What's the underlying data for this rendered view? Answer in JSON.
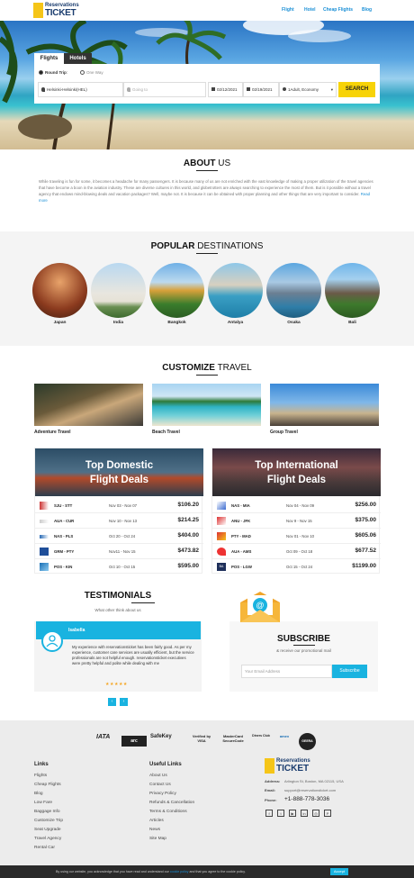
{
  "header": {
    "logo_line1": "Reservations",
    "logo_line2": "TICKET",
    "nav": [
      "Flight",
      "Hotel",
      "Cheap Flights",
      "Blog"
    ]
  },
  "search": {
    "tabs": [
      "Flights",
      "Hotels"
    ],
    "trip_options": [
      "Round Trip",
      "One Way"
    ],
    "from_value": "Helsinki-Helsinki(HEL)",
    "to_placeholder": "Going to",
    "depart_date": "02/12/2021",
    "return_date": "02/19/2021",
    "travellers": "1Adult, Economy",
    "button": "SEARCH"
  },
  "about": {
    "title_bold": "ABOUT",
    "title_rest": " US",
    "text": "While traveling is fun for some, it becomes a headache for many passengers. It is because many of us are not enriched with the vast knowledge of making a proper utilization of the travel agencies that have become a boon in the aviation industry. These are diverse cultures in this world, and globetrotters are always searching to experience the most of them. But is it possible without a travel agency that endows mind-blowing deals and vacation packages? Well, maybe not. It is because it can be obtained with proper planning and other things that are very important to consider.",
    "read_more": "Read more"
  },
  "popular": {
    "title_bold": "POPULAR",
    "title_rest": " DESTINATIONS",
    "items": [
      "Japan",
      "India",
      "Bangkok",
      "Antalya",
      "Osaka",
      "Bali"
    ]
  },
  "customize": {
    "title_bold": "CUSTOMIZE",
    "title_rest": " TRAVEL",
    "items": [
      "Adventure Travel",
      "Beach Travel",
      "Group Travel"
    ]
  },
  "domestic": {
    "title_line1": "Top Domestic",
    "title_line2": "Flight Deals",
    "rows": [
      {
        "route": "SJU - STT",
        "dates": "Nov 03 - Nov 07",
        "price": "$106.20"
      },
      {
        "route": "AUA - CUR",
        "dates": "Nov 10 - Nov 13",
        "price": "$214.25"
      },
      {
        "route": "NAS - PLS",
        "dates": "Oct 20 - Oct 24",
        "price": "$404.00"
      },
      {
        "route": "GRM - PTY",
        "dates": "Nov11 - Nov 15",
        "price": "$473.82"
      },
      {
        "route": "POS - KIN",
        "dates": "Oct 10 - Oct 15",
        "price": "$595.00"
      }
    ]
  },
  "international": {
    "title_line1": "Top International",
    "title_line2": "Flight Deals",
    "rows": [
      {
        "route": "NAS - MIA",
        "dates": "Nov 04 - Nov 09",
        "price": "$256.00"
      },
      {
        "route": "ANU - JFK",
        "dates": "Nov 9 - Nov 15",
        "price": "$375.00"
      },
      {
        "route": "PTY - MAD",
        "dates": "Nov 01 - Nov 10",
        "price": "$605.06"
      },
      {
        "route": "AUA - AMS",
        "dates": "Oct 09 - Oct 18",
        "price": "$677.52"
      },
      {
        "route": "POS - LGW",
        "dates": "Oct 15 - Oct 24",
        "price": "$1199.00"
      }
    ]
  },
  "testimonials": {
    "title": "TESTIMONIALS",
    "subtitle": "What other think about us",
    "name": "Isabella",
    "quote": "My experience with reservationsticket has been fairly good. As per my experience, customer care services are usually efficient, but the service professionals are not helpful enough. reservationsticket executives were pretty helpful and polite while dealing with me",
    "stars": "★★★★★"
  },
  "subscribe": {
    "title": "SUBSCRIBE",
    "subtitle": "& receive our promotional mail",
    "placeholder": "Your Email Address",
    "button": "Subscribe"
  },
  "footer": {
    "badges": [
      "IATA",
      "arc",
      "SafeKey",
      "Verified by VISA",
      "MasterCard SecureCode",
      "Diners Club",
      "amex",
      "GEERA"
    ],
    "links_title": "Links",
    "links": [
      "Flights",
      "Cheap Flights",
      "Blog",
      "Low Fare",
      "Baggage Info",
      "Customize Trip",
      "Seat Upgrade",
      "Travel Agency",
      "Rental Car"
    ],
    "useful_title": "Useful Links",
    "useful": [
      "About Us",
      "Contact Us",
      "Privacy Policy",
      "Refunds & Cancellation",
      "Terms & Conditions",
      "Articles",
      "News",
      "Site Map"
    ],
    "address_label": "Address:",
    "address": "Arlington St, Boston, MA 02115, USA",
    "email_label": "Email:",
    "email": "support@reservationsticket.com",
    "phone_label": "Phone:",
    "phone": "+1-888-778-3036",
    "social": [
      "f",
      "t",
      "▶",
      "in",
      "◎",
      "P"
    ]
  },
  "cookie": {
    "text": "By using our website, you acknowledge that you have read and understand our ",
    "link": "cookie policy",
    "text2": " and that you agree to the cookie policy.",
    "button": "Accept"
  }
}
